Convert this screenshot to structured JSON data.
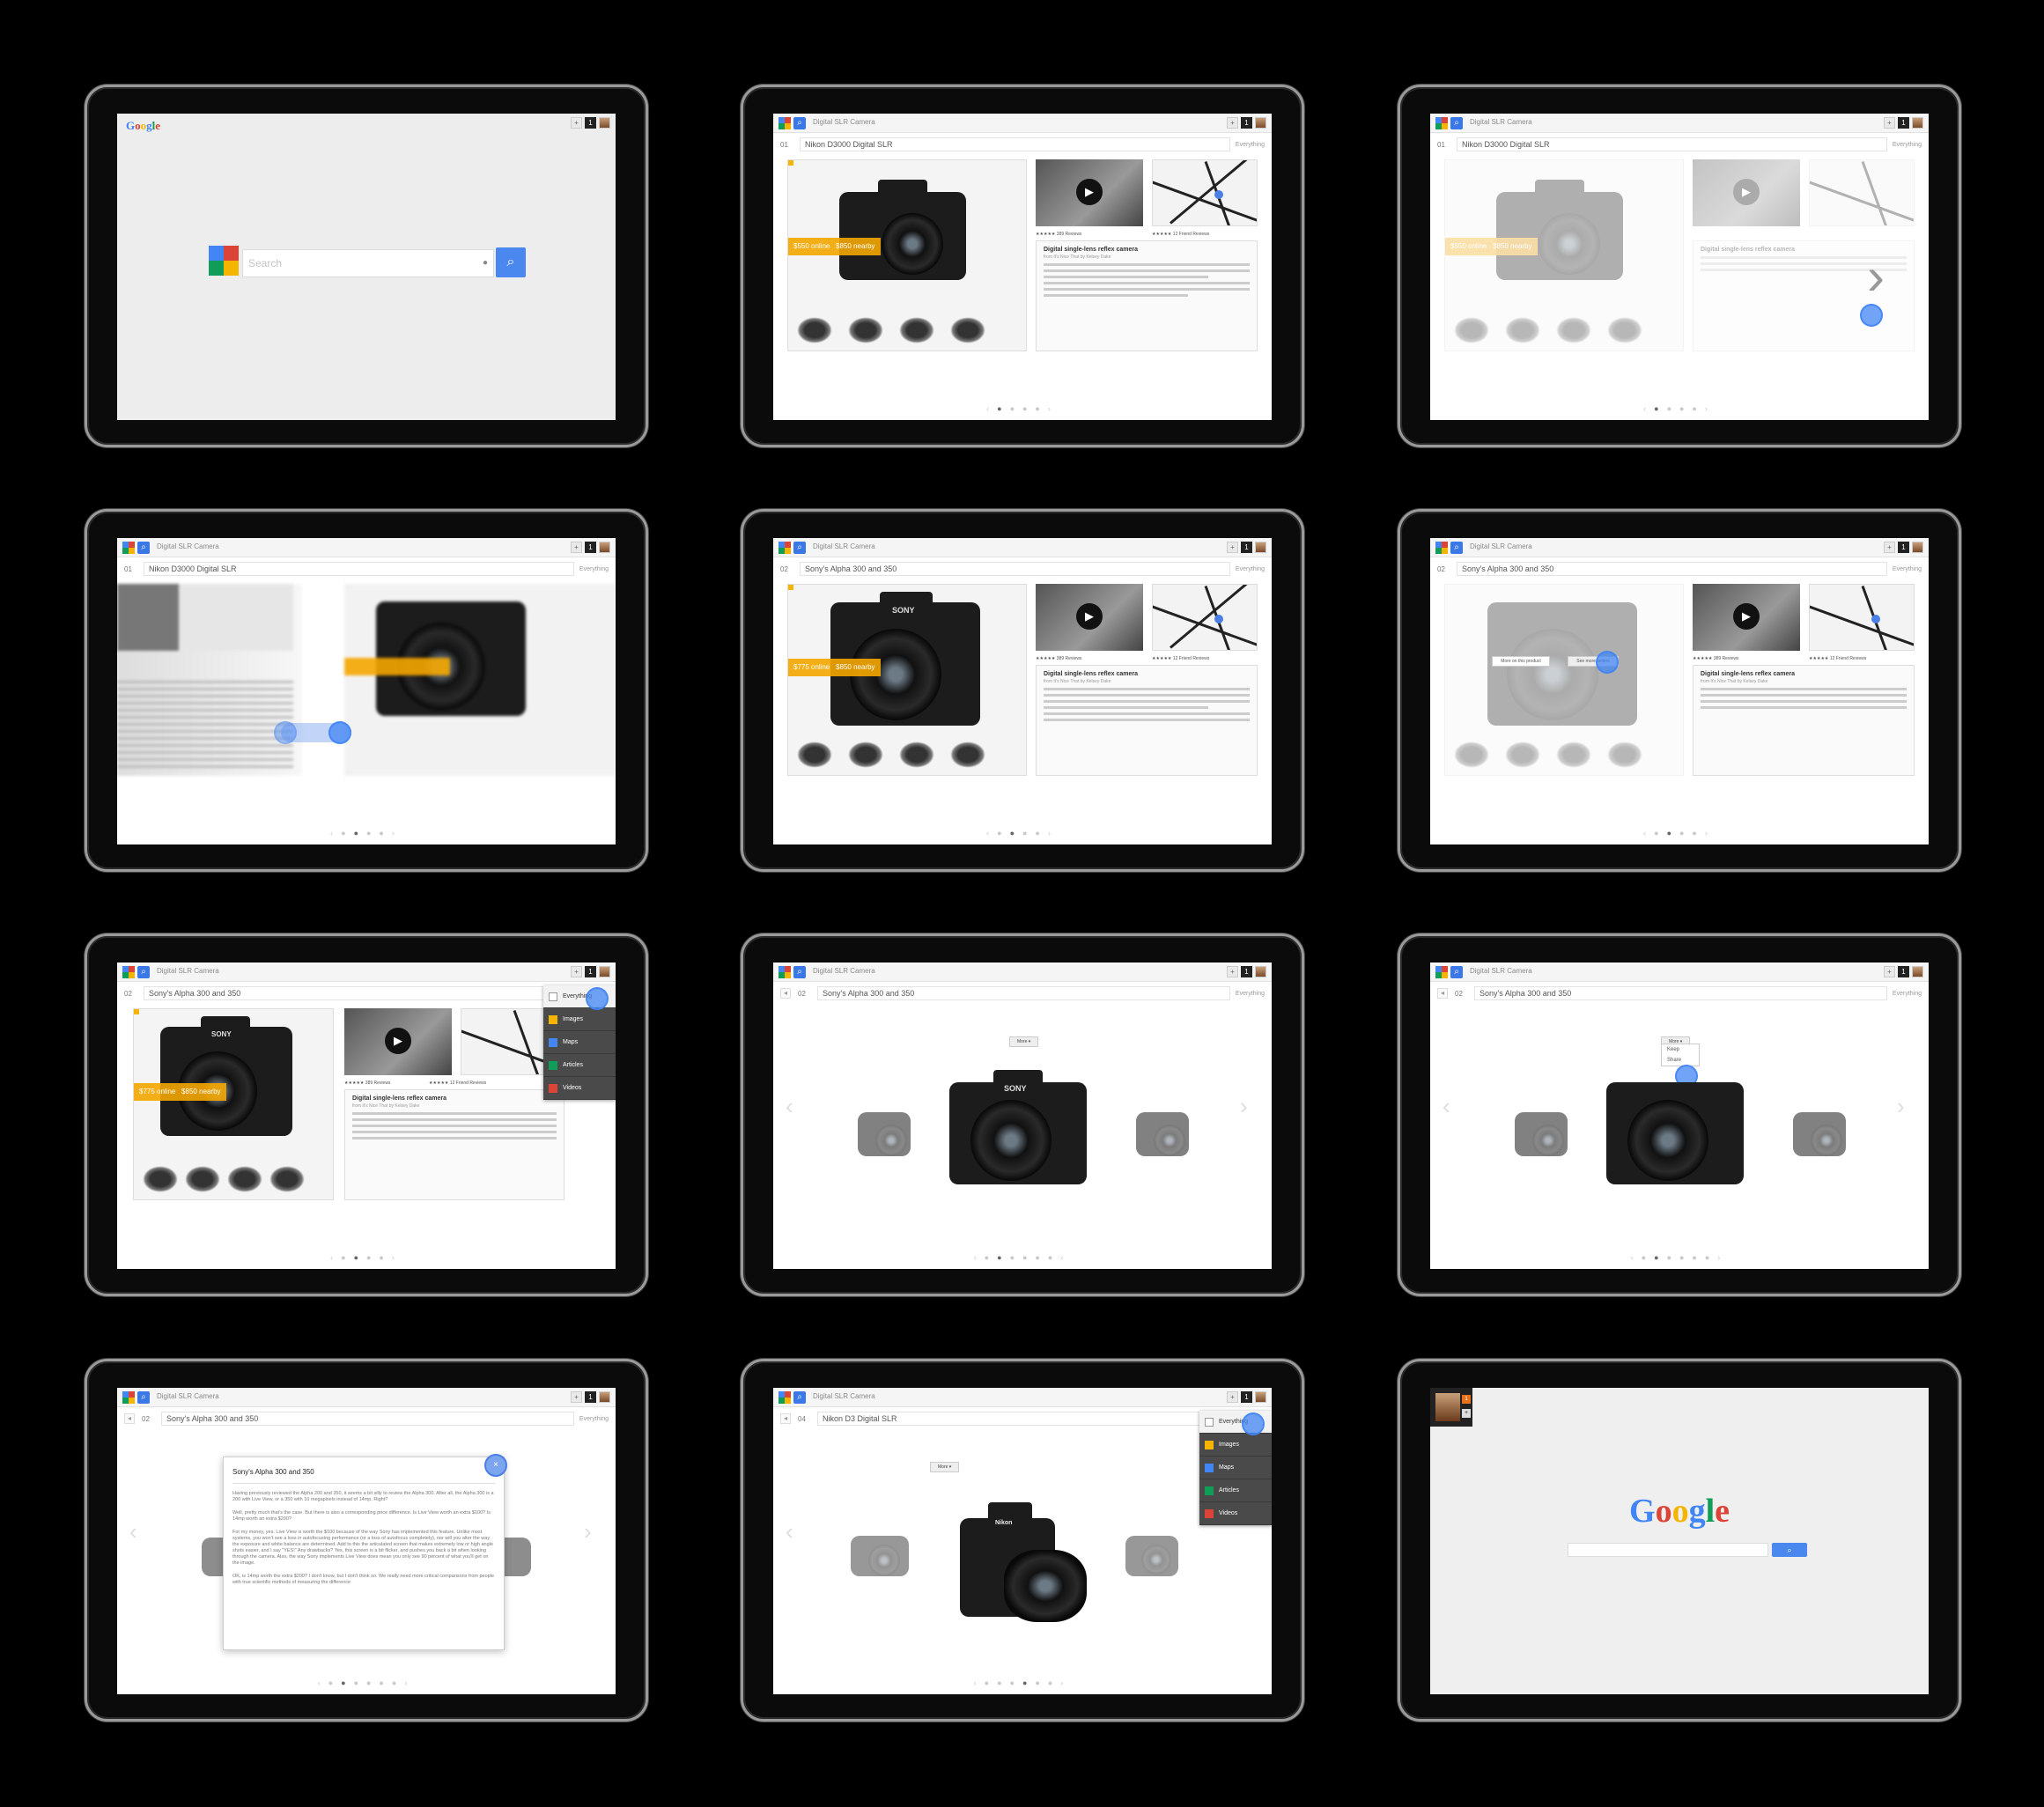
{
  "brand": {
    "logo_text": "Google",
    "logo_letters": [
      "G",
      "o",
      "o",
      "g",
      "l",
      "e"
    ],
    "logo_colors": [
      "#4285f4",
      "#db4437",
      "#f4b400",
      "#4285f4",
      "#0f9d58",
      "#db4437"
    ]
  },
  "search": {
    "placeholder": "Search",
    "query": "Digital SLR Camera",
    "mic_icon": "microphone-icon",
    "button_icon": "magnifier-icon"
  },
  "header": {
    "notification_count": "1",
    "plus": "+"
  },
  "filter": {
    "current": "Everything",
    "options": [
      {
        "label": "Everything",
        "color": "#ffffff"
      },
      {
        "label": "Images",
        "color": "#f4b400"
      },
      {
        "label": "Maps",
        "color": "#4285f4"
      },
      {
        "label": "Articles",
        "color": "#0f9d58"
      },
      {
        "label": "Videos",
        "color": "#db4437"
      }
    ]
  },
  "results": [
    {
      "index": "01",
      "title": "Nikon D3000 Digital SLR",
      "price_online": "$550 online",
      "price_nearby": "$850 nearby",
      "brand_mark": "Nikon"
    },
    {
      "index": "02",
      "title": "Sony's Alpha 300 and 350",
      "price_online": "$775 online",
      "price_nearby": "$850 nearby",
      "brand_mark": "SONY"
    },
    {
      "index": "04",
      "title": "Nikon D3 Digital SLR",
      "brand_mark": "Nikon"
    }
  ],
  "reviews": {
    "count_a": "★★★★★ 389 Reviews",
    "count_b": "★★★★★ 12 Friend Reviews"
  },
  "article": {
    "title": "Digital single-lens reflex camera",
    "source": "from It's Nice That by Kelsey Dake",
    "popup_title": "Sony's Alpha 300 and 350",
    "popup_paragraphs": [
      "Having previously reviewed the Alpha 200 and 350, it seems a bit silly to review the Alpha 300. After all, the Alpha 300 is a 200 with Live View, or a 350 with 10 megapixels instead of 14mp. Right?",
      "Well, pretty much that's the case. But there is also a corresponding price difference. Is Live View worth an extra $100? Is 14mp worth an extra $200?",
      "For my money, yes. Live View is worth the $100 because of the way Sony has implemented this feature. Unlike most systems, you won't see a loss in autofocusing performance (or a loss of autofocus completely), nor will you alter the way the exposure and white balance are determined. Add to this the articulated screen that makes extremely low or high angle shots easier, and I say \"YES!\" Any drawbacks? Yes, this screen is a bit flicker, and pushes you back a bit when looking through the camera. Also, the way Sony implements Live View does mean you only see 90 percent of what you'll get on the image.",
      "OK, is 14mp worth the extra $200? I don't know, but I don't think so. We really need more critical comparisons from people with true scientific methods of measuring the difference"
    ],
    "popup_close": "×"
  },
  "carousel": {
    "more_label": "More ▾",
    "menu": [
      "Keep",
      "Share"
    ],
    "prev": "‹",
    "next": "›"
  },
  "home": {
    "logo": "Google",
    "search_icon": "magnifier-icon"
  }
}
